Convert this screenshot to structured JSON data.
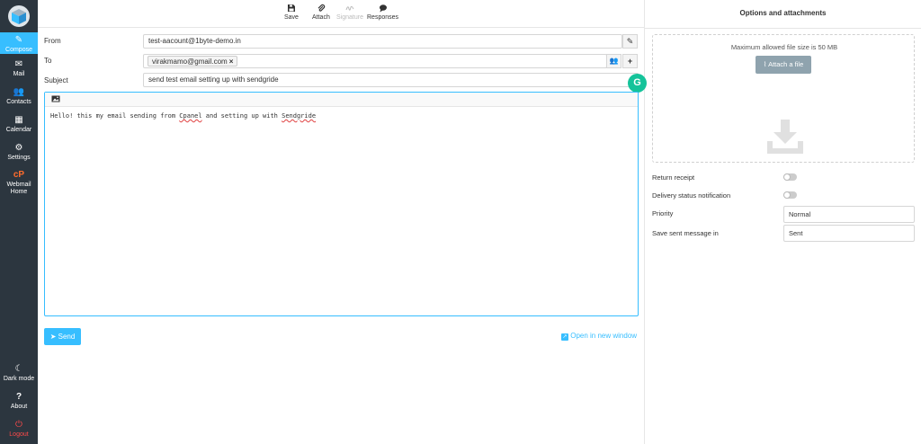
{
  "sidebar": {
    "items": [
      {
        "label": "Compose",
        "icon": "pencil-icon"
      },
      {
        "label": "Mail",
        "icon": "envelope-icon"
      },
      {
        "label": "Contacts",
        "icon": "contacts-icon"
      },
      {
        "label": "Calendar",
        "icon": "calendar-icon"
      },
      {
        "label": "Settings",
        "icon": "gear-icon"
      },
      {
        "label_line1": "Webmail",
        "label_line2": "Home",
        "icon": "cpanel-icon"
      }
    ],
    "bottom": {
      "dark_mode": "Dark mode",
      "about": "About",
      "logout": "Logout"
    }
  },
  "toolbar": {
    "save": "Save",
    "attach": "Attach",
    "signature": "Signature",
    "responses": "Responses"
  },
  "compose": {
    "from_label": "From",
    "from_value": "test-aacount@1byte-demo.in",
    "to_label": "To",
    "to_recipient": "virakmamo@gmail.com",
    "subject_label": "Subject",
    "subject_value": "send test email setting up with sendgride",
    "body_prefix": "Hello! this my email sending from ",
    "body_word1": "Cpanel",
    "body_middle": " and setting up with ",
    "body_word2": "Sendgride",
    "send_label": "Send",
    "open_new_window": "Open in new window"
  },
  "options": {
    "title": "Options and attachments",
    "max_size_hint": "Maximum allowed file size is 50 MB",
    "attach_file": "Attach a file",
    "return_receipt": "Return receipt",
    "delivery_status": "Delivery status notification",
    "priority_label": "Priority",
    "priority_value": "Normal",
    "save_sent_label": "Save sent message in",
    "save_sent_value": "Sent",
    "return_receipt_on": false,
    "delivery_status_on": false
  },
  "colors": {
    "sidebar_bg": "#2c363f",
    "accent": "#37beff",
    "attach_btn": "#8fa3ae"
  }
}
